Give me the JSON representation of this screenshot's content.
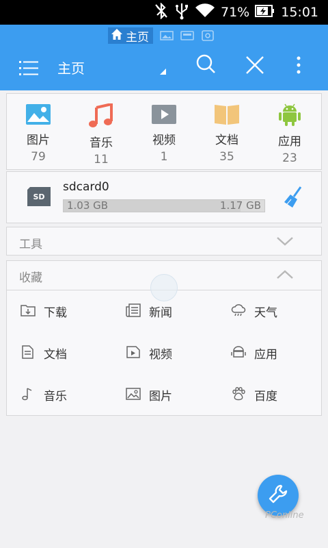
{
  "status_bar": {
    "battery": "71%",
    "time": "15:01",
    "icons": [
      "bluetooth-off-icon",
      "usb-icon",
      "wifi-icon",
      "battery-charging-icon"
    ]
  },
  "app_bar": {
    "tab_label": "主页",
    "title": "主页",
    "icons": [
      "home-icon",
      "menu-icon",
      "search-icon",
      "close-icon",
      "more-vertical-icon"
    ]
  },
  "categories": [
    {
      "label": "图片",
      "count": "79",
      "icon": "image-icon",
      "color": "#42b0e8"
    },
    {
      "label": "音乐",
      "count": "11",
      "icon": "music-icon",
      "color": "#ef6b55"
    },
    {
      "label": "视频",
      "count": "1",
      "icon": "video-icon",
      "color": "#8a939b"
    },
    {
      "label": "文档",
      "count": "35",
      "icon": "document-icon",
      "color": "#f2c57a"
    },
    {
      "label": "应用",
      "count": "23",
      "icon": "android-icon",
      "color": "#8ec63f"
    }
  ],
  "storage": {
    "name": "sdcard0",
    "used": "1.03 GB",
    "total": "1.17 GB",
    "used_fraction": 0.88,
    "sd_label": "SD"
  },
  "tools": {
    "title": "工具"
  },
  "favorites": {
    "title": "收藏",
    "items": [
      {
        "label": "下载",
        "icon": "download-folder-icon"
      },
      {
        "label": "新闻",
        "icon": "news-icon"
      },
      {
        "label": "天气",
        "icon": "weather-icon"
      },
      {
        "label": "文档",
        "icon": "document-icon"
      },
      {
        "label": "视频",
        "icon": "video-file-icon"
      },
      {
        "label": "应用",
        "icon": "app-icon"
      },
      {
        "label": "音乐",
        "icon": "music-icon"
      },
      {
        "label": "图片",
        "icon": "image-icon"
      },
      {
        "label": "百度",
        "icon": "baidu-paw-icon"
      }
    ]
  },
  "fab": {
    "icon": "wrench-icon"
  },
  "watermark": "PConline",
  "colors": {
    "accent": "#3c9df0",
    "statusbar": "#000000",
    "background": "#f1f1f3"
  }
}
